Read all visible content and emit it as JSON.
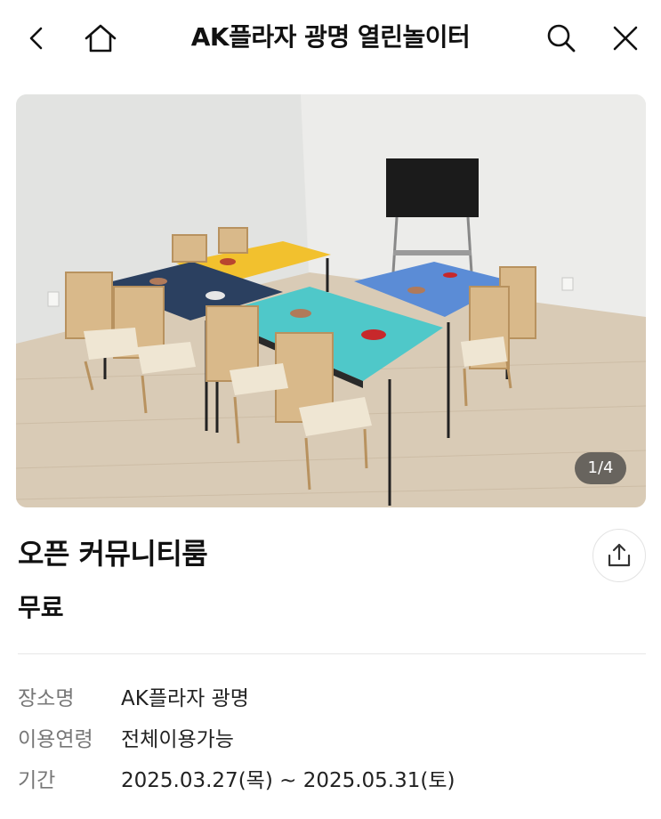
{
  "header": {
    "title": "AK플라자 광명 열린놀이터",
    "back_icon": "chevron-left-icon",
    "home_icon": "home-icon",
    "search_icon": "search-icon",
    "close_icon": "close-icon"
  },
  "gallery": {
    "counter": "1/4",
    "image_description_icon": "photo-room-with-colored-tables"
  },
  "item": {
    "name": "오픈 커뮤니티룸",
    "price": "무료",
    "share_icon": "share-icon"
  },
  "info": [
    {
      "label": "장소명",
      "value": "AK플라자 광명"
    },
    {
      "label": "이용연령",
      "value": "전체이용가능"
    },
    {
      "label": "기간",
      "value": "2025.03.27(목) ~ 2025.05.31(토)"
    }
  ],
  "colors": {
    "table_yellow": "#f2c12e",
    "table_navy": "#2b4060",
    "table_teal": "#4fc8c9",
    "table_blue": "#5b8cd6"
  }
}
